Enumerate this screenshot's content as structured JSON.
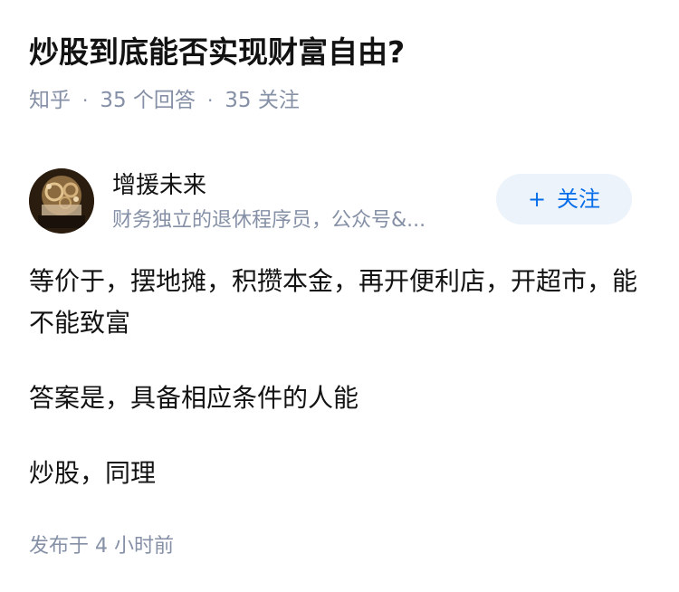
{
  "question": {
    "title": "炒股到底能否实现财富自由?",
    "source": "知乎",
    "answers_count": "35 个回答",
    "followers_count": "35 关注",
    "separator": "·"
  },
  "author": {
    "name": "增援未来",
    "description": "财务独立的退休程序员，公众号&...",
    "avatar_icon": "avatar-image",
    "follow_label": "关注",
    "follow_plus": "+",
    "accent_color": "#056de8"
  },
  "answer": {
    "paragraphs": [
      "等价于，摆地摊，积攒本金，再开便利店，开超市，能不能致富",
      "答案是，具备相应条件的人能",
      "炒股，同理"
    ],
    "posted_time": "发布于 4 小时前"
  }
}
